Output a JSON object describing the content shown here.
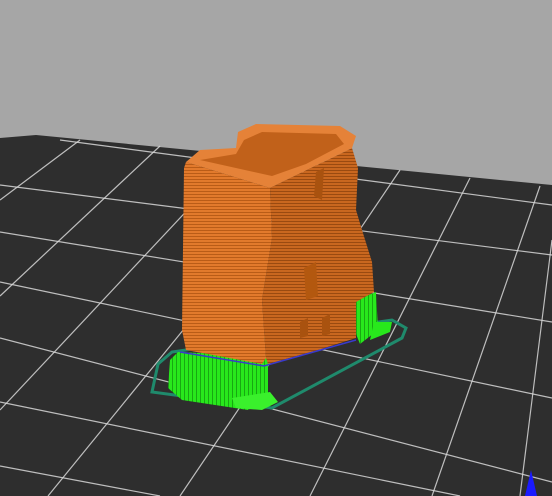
{
  "viewport": {
    "background_color": "#a6a6a6",
    "bed_color": "#2e2e2e",
    "grid_color": "#d8d8d8"
  },
  "model": {
    "outer_wall_color": "#e07628",
    "inner_wall_color": "#b85a16",
    "support_color": "#22e01a",
    "skirt_color": "#1f8a6c"
  },
  "axis_indicator": {
    "icon": "z-axis-arrow-icon",
    "color": "#1a1aff"
  }
}
